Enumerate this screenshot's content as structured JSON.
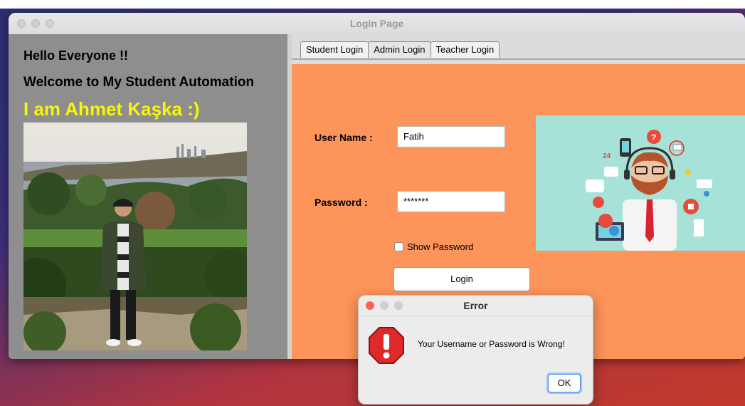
{
  "window": {
    "title": "Login Page"
  },
  "left_panel": {
    "hello": "Hello Everyone !!",
    "welcome": "Welcome to My Student Automation",
    "name": "I am Ahmet Kaşka :)"
  },
  "tabs": [
    {
      "label": "Student Login"
    },
    {
      "label": "Admin Login"
    },
    {
      "label": "Teacher Login"
    }
  ],
  "active_tab": "Admin Login",
  "form": {
    "username_label": "User Name :",
    "username_value": "Fatih",
    "password_label": "Password  :",
    "password_value": "*******",
    "show_password_label": "Show Password",
    "show_password_checked": false,
    "login_button": "Login"
  },
  "illustration": {
    "number_text": "24"
  },
  "dialog": {
    "title": "Error",
    "message": "Your Username or Password is Wrong!",
    "ok_button": "OK"
  },
  "colors": {
    "form_background": "#fd9459",
    "left_panel_background": "#8e8e8e",
    "name_text": "#f7f704",
    "illustration_background": "#a7e2d8",
    "error_red": "#e02a2a"
  }
}
